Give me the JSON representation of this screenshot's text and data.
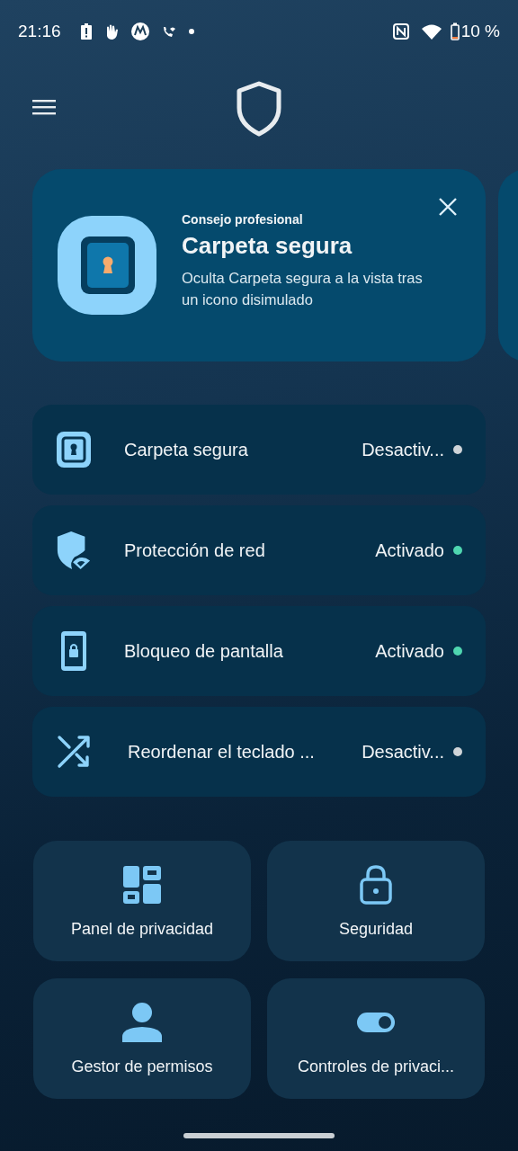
{
  "status_bar": {
    "time": "21:16",
    "battery": "10 %"
  },
  "promo": {
    "eyebrow": "Consejo profesional",
    "title": "Carpeta segura",
    "body": "Oculta Carpeta segura a la vista tras un icono disimulado"
  },
  "features": [
    {
      "kind": "folder",
      "label": "Carpeta segura",
      "status": "Desactiv...",
      "color": "#cfd4d8"
    },
    {
      "kind": "shield",
      "label": "Protección de red",
      "status": "Activado",
      "color": "#4fd6b0"
    },
    {
      "kind": "phone",
      "label": "Bloqueo de pantalla",
      "status": "Activado",
      "color": "#4fd6b0"
    },
    {
      "kind": "shuffle",
      "label": "Reordenar el teclado ...",
      "status": "Desactiv...",
      "color": "#cfd4d8"
    }
  ],
  "tiles": [
    {
      "kind": "dashboard",
      "label": "Panel de privacidad"
    },
    {
      "kind": "lock",
      "label": "Seguridad"
    },
    {
      "kind": "person",
      "label": "Gestor de permisos"
    },
    {
      "kind": "toggle",
      "label": "Controles de privaci..."
    }
  ]
}
